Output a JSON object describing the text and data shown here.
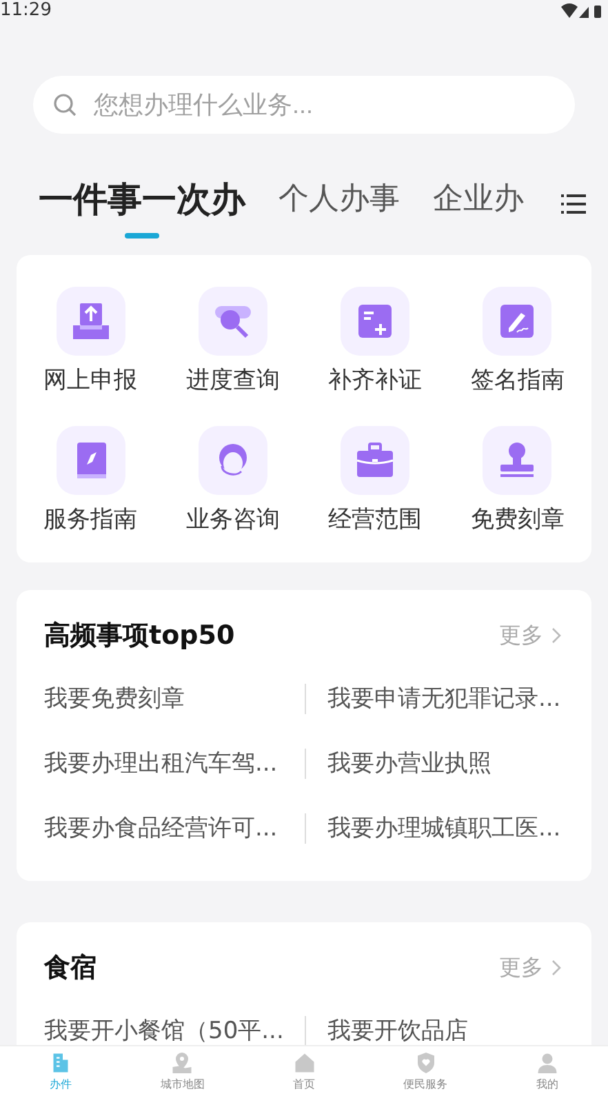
{
  "status_bar": {
    "time": "11:29"
  },
  "search": {
    "placeholder": "您想办理什么业务..."
  },
  "tabs": [
    {
      "label": "一件事一次办",
      "selected": true
    },
    {
      "label": "个人办事",
      "selected": false
    },
    {
      "label": "企业办",
      "selected": false
    }
  ],
  "services": [
    {
      "label": "网上申报",
      "kind": "upload"
    },
    {
      "label": "进度查询",
      "kind": "search"
    },
    {
      "label": "补齐补证",
      "kind": "add"
    },
    {
      "label": "签名指南",
      "kind": "sign"
    },
    {
      "label": "服务指南",
      "kind": "book"
    },
    {
      "label": "业务咨询",
      "kind": "agent"
    },
    {
      "label": "经营范围",
      "kind": "briefcase"
    },
    {
      "label": "免费刻章",
      "kind": "stamp"
    }
  ],
  "sections": [
    {
      "title": "高频事项top50",
      "more": "更多",
      "items": [
        "我要免费刻章",
        "我要申请无犯罪记录...",
        "我要办理出租汽车驾...",
        "我要办营业执照",
        "我要办食品经营许可...",
        "我要办理城镇职工医..."
      ]
    },
    {
      "title": "食宿",
      "more": "更多",
      "items": [
        "我要开小餐馆（50平...",
        "我要开饮品店"
      ]
    }
  ],
  "bottom_nav": [
    {
      "label": "办件",
      "selected": true,
      "kind": "building"
    },
    {
      "label": "城市地图",
      "selected": false,
      "kind": "map"
    },
    {
      "label": "首页",
      "selected": false,
      "kind": "home"
    },
    {
      "label": "便民服务",
      "selected": false,
      "kind": "shield"
    },
    {
      "label": "我的",
      "selected": false,
      "kind": "user"
    }
  ]
}
